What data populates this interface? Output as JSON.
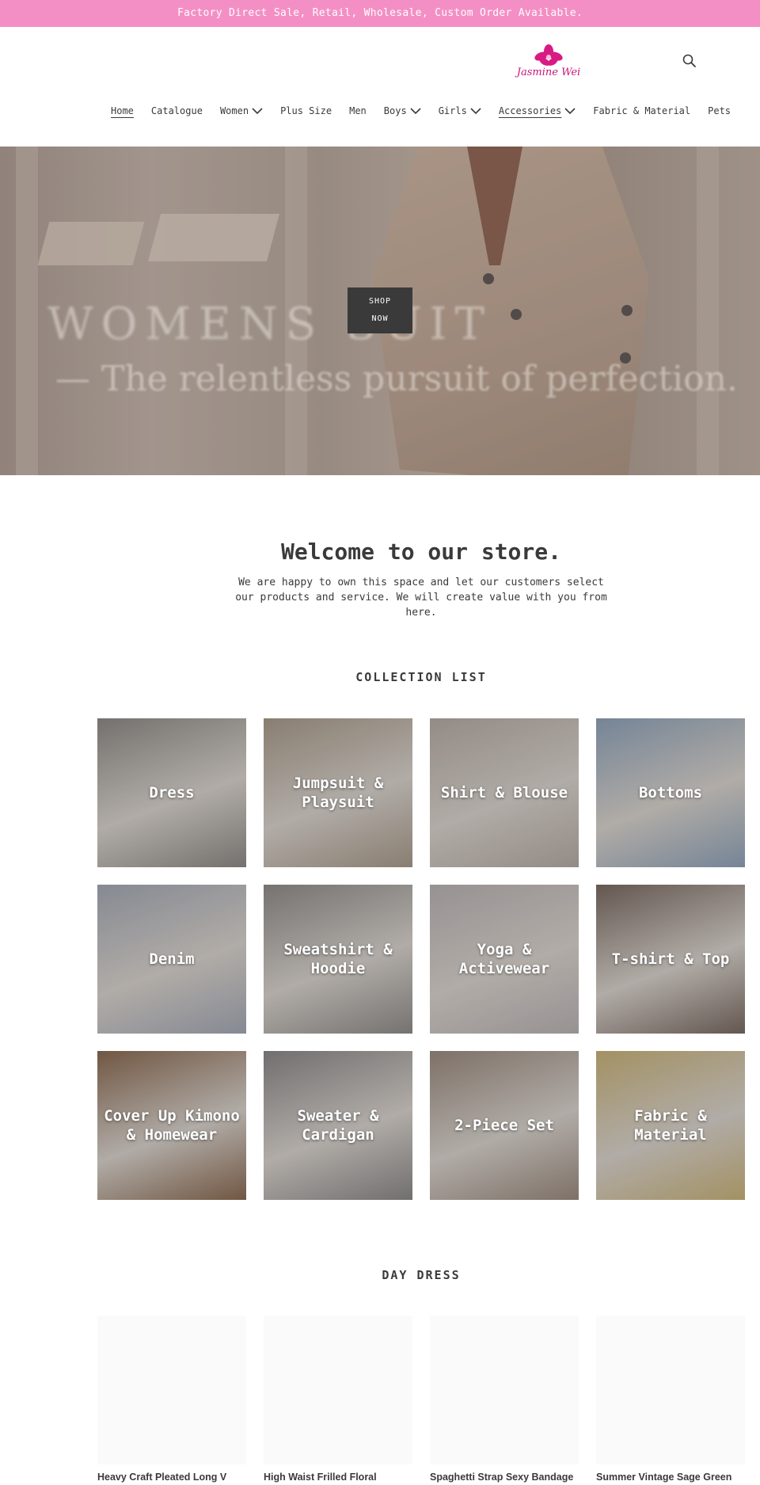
{
  "announcement": "Factory Direct Sale, Retail, Wholesale, Custom Order Available.",
  "brand": {
    "logo_text": "Jasmine Wei",
    "accent": "#c8157a",
    "announce_bg": "#f48fc5"
  },
  "nav": {
    "items": [
      {
        "label": "Home",
        "has_dropdown": false,
        "active": true
      },
      {
        "label": "Catalogue",
        "has_dropdown": false
      },
      {
        "label": "Women",
        "has_dropdown": true
      },
      {
        "label": "Plus Size",
        "has_dropdown": false
      },
      {
        "label": "Men",
        "has_dropdown": false
      },
      {
        "label": "Boys",
        "has_dropdown": true
      },
      {
        "label": "Girls",
        "has_dropdown": true
      },
      {
        "label": "Accessories",
        "has_dropdown": true,
        "active": true
      },
      {
        "label": "Fabric & Material",
        "has_dropdown": false
      },
      {
        "label": "Pets",
        "has_dropdown": false
      }
    ],
    "search_icon": "search-icon"
  },
  "hero": {
    "headline": "WOMENS SUIT",
    "tagline": "— The relentless pursuit of perfection.",
    "button_line1": "SHOP",
    "button_line2": "NOW"
  },
  "welcome": {
    "title": "Welcome to our store.",
    "text": "We are happy to own this space and let our customers select our products and service. We will create value with you from here."
  },
  "collections": {
    "title": "COLLECTION LIST",
    "items": [
      {
        "label": "Dress",
        "color": "#8e8a86"
      },
      {
        "label": "Jumpsuit & Playsuit",
        "color": "#a89a8a"
      },
      {
        "label": "Shirt & Blouse",
        "color": "#b4aaa4"
      },
      {
        "label": "Bottoms",
        "color": "#8fa2b8"
      },
      {
        "label": "Denim",
        "color": "#a4a8b4"
      },
      {
        "label": "Sweatshirt & Hoodie",
        "color": "#8f8c8a"
      },
      {
        "label": "Yoga & Activewear",
        "color": "#b9b3b3"
      },
      {
        "label": "T-shirt & Top",
        "color": "#7a6a62"
      },
      {
        "label": "Cover Up Kimono & Homewear",
        "color": "#8a6a52"
      },
      {
        "label": "Sweater & Cardigan",
        "color": "#8a8788"
      },
      {
        "label": "2-Piece Set",
        "color": "#9a8a7e"
      },
      {
        "label": "Fabric & Material",
        "color": "#c8b27a"
      }
    ]
  },
  "day_dress": {
    "title": "DAY DRESS",
    "products": [
      {
        "title": "Heavy Craft Pleated Long V"
      },
      {
        "title": "High Waist Frilled Floral"
      },
      {
        "title": "Spaghetti Strap Sexy Bandage"
      },
      {
        "title": "Summer Vintage Sage Green"
      }
    ]
  }
}
